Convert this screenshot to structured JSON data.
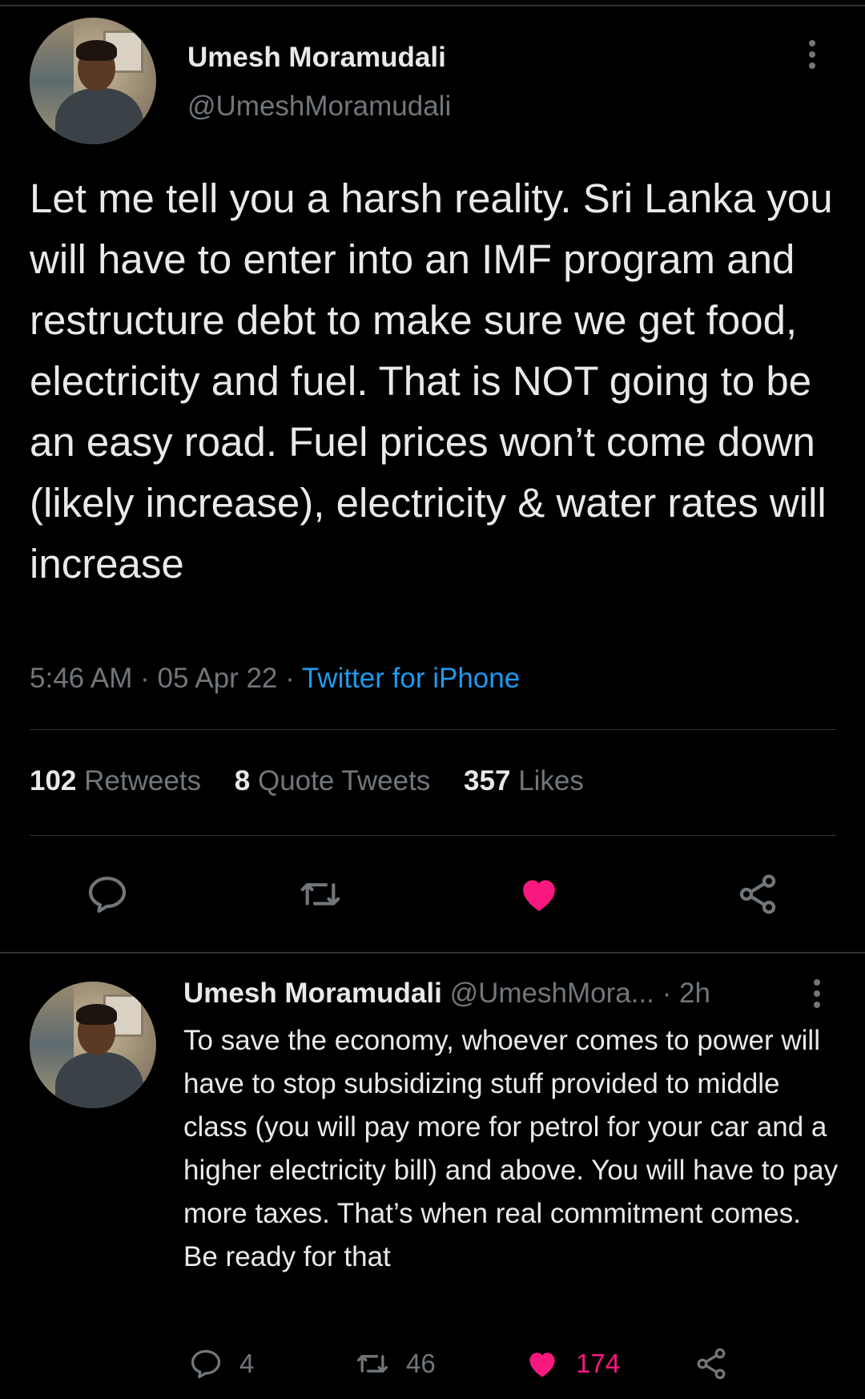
{
  "tweet": {
    "author_name": "Umesh Moramudali",
    "author_handle": "@UmeshMoramudali",
    "text": "Let me tell you a harsh reality. Sri Lanka you will have to enter into an IMF program and restructure debt to make sure we get food, electricity and fuel. That is NOT going to be an easy road. Fuel prices won’t come down (likely increase), electricity & water rates will increase",
    "time": "5:46 AM",
    "date": "05 Apr 22",
    "source": "Twitter for iPhone",
    "retweets_count": "102",
    "retweets_label": "Retweets",
    "quotes_count": "8",
    "quotes_label": "Quote Tweets",
    "likes_count": "357",
    "likes_label": "Likes",
    "liked": true,
    "icons": [
      "reply-icon",
      "retweet-icon",
      "heart-icon",
      "share-icon"
    ]
  },
  "reply": {
    "author_name": "Umesh Moramudali",
    "author_handle": "@UmeshMora...",
    "time_ago": "2h",
    "text": "To save the economy, whoever comes to power will have to stop subsidizing stuff provided to middle class (you will pay more for petrol for your car and a higher electricity bill) and above. You will have to pay more taxes. That’s when real commitment comes. Be ready for that",
    "reply_count": "4",
    "retweet_count": "46",
    "like_count": "174",
    "liked": true
  },
  "colors": {
    "background": "#000000",
    "text": "#e7e9ea",
    "secondary": "#71767b",
    "link": "#1d9bf0",
    "like": "#f91880",
    "divider": "#2f3336"
  }
}
